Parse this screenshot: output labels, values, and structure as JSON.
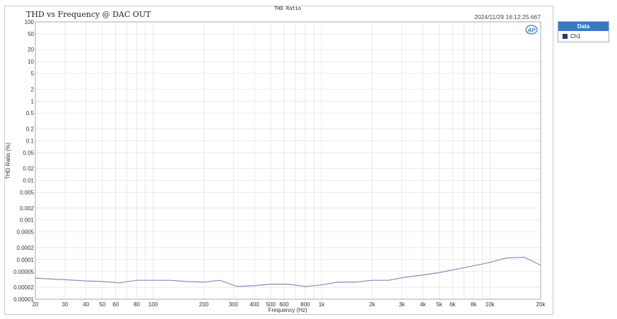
{
  "header": {
    "top_label": "THD Ratio",
    "timestamp": "2024/11/29 16:12:25.667",
    "logo_text": "AP"
  },
  "legend": {
    "title": "Data",
    "items": [
      {
        "name": "Ch1",
        "color": "#1f3a73"
      }
    ]
  },
  "colors": {
    "series": "#8090b8",
    "grid": "#dcdcdc",
    "legend_header": "#3a78c2"
  },
  "chart_data": {
    "type": "line",
    "title": "THD vs Frequency @ DAC OUT",
    "xlabel": "Frequency (Hz)",
    "ylabel": "THD Ratio (%)",
    "x_scale": "log",
    "y_scale": "log",
    "xlim": [
      20,
      20000
    ],
    "ylim": [
      1e-05,
      100
    ],
    "grid": true,
    "legend_placement": "outside-right",
    "x_ticks": [
      {
        "v": 20,
        "label": "20"
      },
      {
        "v": 30,
        "label": "30"
      },
      {
        "v": 40,
        "label": "40"
      },
      {
        "v": 50,
        "label": "50"
      },
      {
        "v": 60,
        "label": "60"
      },
      {
        "v": 80,
        "label": "80"
      },
      {
        "v": 100,
        "label": "100"
      },
      {
        "v": 200,
        "label": "200"
      },
      {
        "v": 300,
        "label": "300"
      },
      {
        "v": 400,
        "label": "400"
      },
      {
        "v": 500,
        "label": "500"
      },
      {
        "v": 600,
        "label": "600"
      },
      {
        "v": 800,
        "label": "800"
      },
      {
        "v": 1000,
        "label": "1k"
      },
      {
        "v": 2000,
        "label": "2k"
      },
      {
        "v": 3000,
        "label": "3k"
      },
      {
        "v": 4000,
        "label": "4k"
      },
      {
        "v": 5000,
        "label": "5k"
      },
      {
        "v": 6000,
        "label": "6k"
      },
      {
        "v": 8000,
        "label": "8k"
      },
      {
        "v": 10000,
        "label": "10k"
      },
      {
        "v": 20000,
        "label": "20k"
      }
    ],
    "y_ticks": [
      {
        "v": 100,
        "label": "100"
      },
      {
        "v": 50,
        "label": "50"
      },
      {
        "v": 20,
        "label": "20"
      },
      {
        "v": 10,
        "label": "10"
      },
      {
        "v": 5,
        "label": "5"
      },
      {
        "v": 2,
        "label": "2"
      },
      {
        "v": 1,
        "label": "1"
      },
      {
        "v": 0.5,
        "label": "0.5"
      },
      {
        "v": 0.2,
        "label": "0.2"
      },
      {
        "v": 0.1,
        "label": "0.1"
      },
      {
        "v": 0.05,
        "label": "0.05"
      },
      {
        "v": 0.02,
        "label": "0.02"
      },
      {
        "v": 0.01,
        "label": "0.01"
      },
      {
        "v": 0.005,
        "label": "0.005"
      },
      {
        "v": 0.002,
        "label": "0.002"
      },
      {
        "v": 0.001,
        "label": "0.001"
      },
      {
        "v": 0.0005,
        "label": "0.0005"
      },
      {
        "v": 0.0002,
        "label": "0.0002"
      },
      {
        "v": 0.0001,
        "label": "0.0001"
      },
      {
        "v": 5e-05,
        "label": "0.00005"
      },
      {
        "v": 2e-05,
        "label": "0.00002"
      },
      {
        "v": 1e-05,
        "label": "0.00001"
      }
    ],
    "series": [
      {
        "name": "Ch1",
        "x": [
          20,
          30,
          40,
          50,
          63,
          80,
          100,
          125,
          160,
          200,
          250,
          315,
          400,
          500,
          630,
          800,
          1000,
          1250,
          1600,
          2000,
          2500,
          3150,
          4000,
          5000,
          6300,
          8000,
          10000,
          12500,
          16000,
          20000
        ],
        "y": [
          3.4e-05,
          3.1e-05,
          2.9e-05,
          2.8e-05,
          2.6e-05,
          3e-05,
          3e-05,
          3e-05,
          2.8e-05,
          2.7e-05,
          3e-05,
          2.1e-05,
          2.2e-05,
          2.4e-05,
          2.4e-05,
          2.1e-05,
          2.3e-05,
          2.7e-05,
          2.7e-05,
          3e-05,
          3e-05,
          3.6e-05,
          4.1e-05,
          4.7e-05,
          5.7e-05,
          7e-05,
          8.5e-05,
          0.00011,
          0.000115,
          7.2e-05
        ]
      }
    ]
  }
}
